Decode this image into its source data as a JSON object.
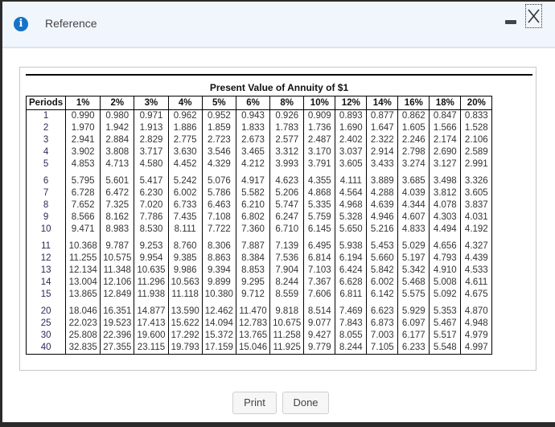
{
  "window": {
    "title": "Reference",
    "icons": {
      "info": "info-icon",
      "minimize": "minimize-icon",
      "close": "close-icon"
    }
  },
  "table": {
    "title": "Present Value of Annuity of $1",
    "headers": [
      "Periods",
      "1%",
      "2%",
      "3%",
      "4%",
      "5%",
      "6%",
      "8%",
      "10%",
      "12%",
      "14%",
      "16%",
      "18%",
      "20%"
    ],
    "rows": [
      [
        "1",
        "0.990",
        "0.980",
        "0.971",
        "0.962",
        "0.952",
        "0.943",
        "0.926",
        "0.909",
        "0.893",
        "0.877",
        "0.862",
        "0.847",
        "0.833"
      ],
      [
        "2",
        "1.970",
        "1.942",
        "1.913",
        "1.886",
        "1.859",
        "1.833",
        "1.783",
        "1.736",
        "1.690",
        "1.647",
        "1.605",
        "1.566",
        "1.528"
      ],
      [
        "3",
        "2.941",
        "2.884",
        "2.829",
        "2.775",
        "2.723",
        "2.673",
        "2.577",
        "2.487",
        "2.402",
        "2.322",
        "2.246",
        "2.174",
        "2.106"
      ],
      [
        "4",
        "3.902",
        "3.808",
        "3.717",
        "3.630",
        "3.546",
        "3.465",
        "3.312",
        "3.170",
        "3.037",
        "2.914",
        "2.798",
        "2.690",
        "2.589"
      ],
      [
        "5",
        "4.853",
        "4.713",
        "4.580",
        "4.452",
        "4.329",
        "4.212",
        "3.993",
        "3.791",
        "3.605",
        "3.433",
        "3.274",
        "3.127",
        "2.991"
      ],
      [
        "6",
        "5.795",
        "5.601",
        "5.417",
        "5.242",
        "5.076",
        "4.917",
        "4.623",
        "4.355",
        "4.111",
        "3.889",
        "3.685",
        "3.498",
        "3.326"
      ],
      [
        "7",
        "6.728",
        "6.472",
        "6.230",
        "6.002",
        "5.786",
        "5.582",
        "5.206",
        "4.868",
        "4.564",
        "4.288",
        "4.039",
        "3.812",
        "3.605"
      ],
      [
        "8",
        "7.652",
        "7.325",
        "7.020",
        "6.733",
        "6.463",
        "6.210",
        "5.747",
        "5.335",
        "4.968",
        "4.639",
        "4.344",
        "4.078",
        "3.837"
      ],
      [
        "9",
        "8.566",
        "8.162",
        "7.786",
        "7.435",
        "7.108",
        "6.802",
        "6.247",
        "5.759",
        "5.328",
        "4.946",
        "4.607",
        "4.303",
        "4.031"
      ],
      [
        "10",
        "9.471",
        "8.983",
        "8.530",
        "8.111",
        "7.722",
        "7.360",
        "6.710",
        "6.145",
        "5.650",
        "5.216",
        "4.833",
        "4.494",
        "4.192"
      ],
      [
        "11",
        "10.368",
        "9.787",
        "9.253",
        "8.760",
        "8.306",
        "7.887",
        "7.139",
        "6.495",
        "5.938",
        "5.453",
        "5.029",
        "4.656",
        "4.327"
      ],
      [
        "12",
        "11.255",
        "10.575",
        "9.954",
        "9.385",
        "8.863",
        "8.384",
        "7.536",
        "6.814",
        "6.194",
        "5.660",
        "5.197",
        "4.793",
        "4.439"
      ],
      [
        "13",
        "12.134",
        "11.348",
        "10.635",
        "9.986",
        "9.394",
        "8.853",
        "7.904",
        "7.103",
        "6.424",
        "5.842",
        "5.342",
        "4.910",
        "4.533"
      ],
      [
        "14",
        "13.004",
        "12.106",
        "11.296",
        "10.563",
        "9.899",
        "9.295",
        "8.244",
        "7.367",
        "6.628",
        "6.002",
        "5.468",
        "5.008",
        "4.611"
      ],
      [
        "15",
        "13.865",
        "12.849",
        "11.938",
        "11.118",
        "10.380",
        "9.712",
        "8.559",
        "7.606",
        "6.811",
        "6.142",
        "5.575",
        "5.092",
        "4.675"
      ],
      [
        "20",
        "18.046",
        "16.351",
        "14.877",
        "13.590",
        "12.462",
        "11.470",
        "9.818",
        "8.514",
        "7.469",
        "6.623",
        "5.929",
        "5.353",
        "4.870"
      ],
      [
        "25",
        "22.023",
        "19.523",
        "17.413",
        "15.622",
        "14.094",
        "12.783",
        "10.675",
        "9.077",
        "7.843",
        "6.873",
        "6.097",
        "5.467",
        "4.948"
      ],
      [
        "30",
        "25.808",
        "22.396",
        "19.600",
        "17.292",
        "15.372",
        "13.765",
        "11.258",
        "9.427",
        "8.055",
        "7.003",
        "6.177",
        "5.517",
        "4.979"
      ],
      [
        "40",
        "32.835",
        "27.355",
        "23.115",
        "19.793",
        "17.159",
        "15.046",
        "11.925",
        "9.779",
        "8.244",
        "7.105",
        "6.233",
        "5.548",
        "4.997"
      ]
    ],
    "group_breaks_before": [
      "6",
      "11",
      "20"
    ]
  },
  "buttons": {
    "print": "Print",
    "done": "Done"
  },
  "colors": {
    "titlebar_bg": "#f1f6fd",
    "info_icon": "#1673c8",
    "frame": "#2b2b2b"
  }
}
